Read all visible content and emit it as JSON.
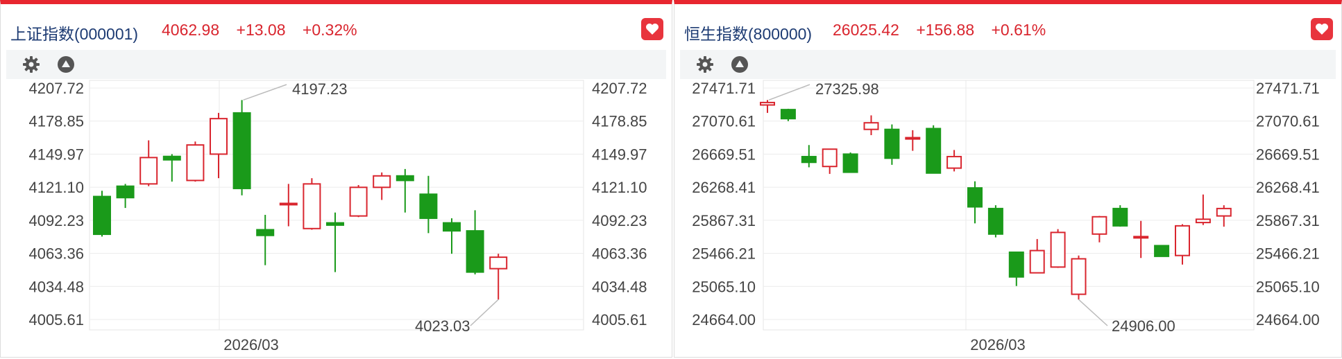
{
  "colors": {
    "up": "#d9252e",
    "down": "#1a9a1a",
    "accent": "#e8262f",
    "title": "#1d3b73"
  },
  "icons": {
    "favorite": "heart-icon",
    "settings": "gear-icon",
    "collapse": "triangle-up-circle-icon"
  },
  "panels": [
    {
      "name": "上证指数(000001)",
      "price": "4062.98",
      "change": "+13.08",
      "change_pct": "+0.32%"
    },
    {
      "name": "恒生指数(800000)",
      "price": "26025.42",
      "change": "+156.88",
      "change_pct": "+0.61%"
    }
  ],
  "chart_data": [
    {
      "type": "candlestick",
      "x_label": "2026/03",
      "y_ticks": [
        "4207.72",
        "4178.85",
        "4149.97",
        "4121.10",
        "4092.23",
        "4063.36",
        "4034.48",
        "4005.61"
      ],
      "ylim": [
        4005.61,
        4207.72
      ],
      "grid": true,
      "high_annotation": "4197.23",
      "low_annotation": "4023.03",
      "candles": [
        {
          "o": 4113,
          "h": 4118,
          "l": 4078,
          "c": 4080
        },
        {
          "o": 4122,
          "h": 4124,
          "l": 4103,
          "c": 4112
        },
        {
          "o": 4124,
          "h": 4162,
          "l": 4122,
          "c": 4147
        },
        {
          "o": 4148,
          "h": 4150,
          "l": 4126,
          "c": 4145
        },
        {
          "o": 4127,
          "h": 4161,
          "l": 4126,
          "c": 4158
        },
        {
          "o": 4150,
          "h": 4186,
          "l": 4129,
          "c": 4181
        },
        {
          "o": 4186,
          "h": 4197.23,
          "l": 4114,
          "c": 4120
        },
        {
          "o": 4084,
          "h": 4097,
          "l": 4053,
          "c": 4079
        },
        {
          "o": 4106,
          "h": 4124,
          "l": 4087,
          "c": 4107
        },
        {
          "o": 4085,
          "h": 4129,
          "l": 4084,
          "c": 4124
        },
        {
          "o": 4090,
          "h": 4099,
          "l": 4047,
          "c": 4088
        },
        {
          "o": 4096,
          "h": 4123,
          "l": 4095,
          "c": 4121
        },
        {
          "o": 4121,
          "h": 4134,
          "l": 4110,
          "c": 4131
        },
        {
          "o": 4131,
          "h": 4137,
          "l": 4099,
          "c": 4127
        },
        {
          "o": 4115,
          "h": 4131,
          "l": 4081,
          "c": 4094
        },
        {
          "o": 4090,
          "h": 4094,
          "l": 4063,
          "c": 4083
        },
        {
          "o": 4083,
          "h": 4101,
          "l": 4045,
          "c": 4047
        },
        {
          "o": 4050,
          "h": 4063,
          "l": 4023.03,
          "c": 4060
        }
      ]
    },
    {
      "type": "candlestick",
      "x_label": "2026/03",
      "y_ticks": [
        "27471.71",
        "27070.61",
        "26669.51",
        "26268.41",
        "25867.31",
        "25466.21",
        "25065.10",
        "24664.00"
      ],
      "ylim": [
        24664.0,
        27471.71
      ],
      "grid": true,
      "high_annotation": "27325.98",
      "low_annotation": "24906.00",
      "candles": [
        {
          "o": 27266,
          "h": 27325.98,
          "l": 27170,
          "c": 27296
        },
        {
          "o": 27210,
          "h": 27220,
          "l": 27070,
          "c": 27100
        },
        {
          "o": 26640,
          "h": 26780,
          "l": 26510,
          "c": 26570
        },
        {
          "o": 26520,
          "h": 26710,
          "l": 26430,
          "c": 26730
        },
        {
          "o": 26670,
          "h": 26690,
          "l": 26450,
          "c": 26450
        },
        {
          "o": 26970,
          "h": 27140,
          "l": 26900,
          "c": 27050
        },
        {
          "o": 26970,
          "h": 27030,
          "l": 26540,
          "c": 26620
        },
        {
          "o": 26860,
          "h": 26960,
          "l": 26710,
          "c": 26870
        },
        {
          "o": 26980,
          "h": 27020,
          "l": 26440,
          "c": 26440
        },
        {
          "o": 26500,
          "h": 26720,
          "l": 26460,
          "c": 26640
        },
        {
          "o": 26260,
          "h": 26340,
          "l": 25830,
          "c": 26030
        },
        {
          "o": 26010,
          "h": 26050,
          "l": 25660,
          "c": 25700
        },
        {
          "o": 25480,
          "h": 25480,
          "l": 25070,
          "c": 25180
        },
        {
          "o": 25230,
          "h": 25640,
          "l": 25230,
          "c": 25500
        },
        {
          "o": 25300,
          "h": 25760,
          "l": 25290,
          "c": 25720
        },
        {
          "o": 24970,
          "h": 25440,
          "l": 24906.0,
          "c": 25400
        },
        {
          "o": 25700,
          "h": 25920,
          "l": 25600,
          "c": 25910
        },
        {
          "o": 26010,
          "h": 26050,
          "l": 25790,
          "c": 25800
        },
        {
          "o": 25670,
          "h": 25860,
          "l": 25410,
          "c": 25670
        },
        {
          "o": 25560,
          "h": 25560,
          "l": 25470,
          "c": 25430
        },
        {
          "o": 25440,
          "h": 25820,
          "l": 25330,
          "c": 25800
        },
        {
          "o": 25840,
          "h": 26180,
          "l": 25810,
          "c": 25880
        },
        {
          "o": 25920,
          "h": 26050,
          "l": 25790,
          "c": 26010
        }
      ]
    }
  ]
}
